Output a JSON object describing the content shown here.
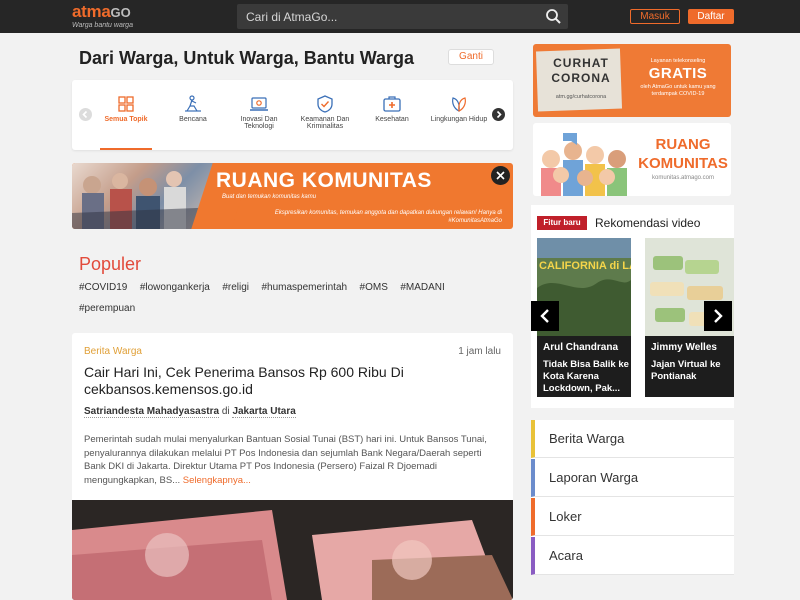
{
  "header": {
    "logo_main": "atma",
    "logo_go": "GO",
    "logo_tagline": "Warga bantu warga",
    "search_placeholder": "Cari di AtmaGo...",
    "login_label": "Masuk",
    "register_label": "Daftar"
  },
  "main": {
    "tagline": "Dari Warga, Untuk Warga, Bantu Warga",
    "change_label": "Ganti",
    "topics": [
      {
        "label": "Semua Topik",
        "icon": "grid-icon",
        "active": true
      },
      {
        "label": "Bencana",
        "icon": "disaster-icon",
        "active": false
      },
      {
        "label": "Inovasi Dan Teknologi",
        "icon": "technology-icon",
        "active": false
      },
      {
        "label": "Keamanan Dan Kriminalitas",
        "icon": "shield-icon",
        "active": false
      },
      {
        "label": "Kesehatan",
        "icon": "health-icon",
        "active": false
      },
      {
        "label": "Lingkungan Hidup",
        "icon": "leaf-icon",
        "active": false
      }
    ],
    "banner": {
      "title": "RUANG KOMUNITAS",
      "subtitle": "Buat dan temukan komunitas kamu",
      "description": "Ekspresikan komunitas, temukan anggota dan dapatkan dukungan relawan! Hanya di #KomunitasAtmaGo"
    },
    "populer": {
      "title": "Populer",
      "tags": [
        "#COVID19",
        "#lowongankerja",
        "#religi",
        "#humaspemerintah",
        "#OMS",
        "#MADANI",
        "#perempuan"
      ]
    },
    "post": {
      "category": "Berita Warga",
      "time": "1 jam lalu",
      "title": "Cair Hari Ini, Cek Penerima Bansos Rp 600 Ribu Di cekbansos.kemensos.go.id",
      "author": "Satriandesta Mahadyasastra",
      "author_prep": "di",
      "location": "Jakarta Utara",
      "excerpt": "Pemerintah sudah mulai menyalurkan Bantuan Sosial Tunai (BST) hari ini. Untuk Bansos Tunai, penyalurannya dilakukan melalui PT Pos Indonesia dan sejumlah Bank Negara/Daerah seperti Bank DKI di Jakarta. Direktur Utama PT Pos Indonesia (Persero) Faizal R Djoemadi mengungkapkan, BS...",
      "more_label": "Selengkapnya..."
    }
  },
  "sidebar": {
    "curhat": {
      "title_line1": "CURHAT",
      "title_line2": "CORONA",
      "url": "atm.gg/curhatcorona",
      "service": "Layanan telekonseling",
      "free": "GRATIS",
      "by": "oleh AtmaGo untuk kamu yang terdampak COVID-19"
    },
    "ruang_komunitas": {
      "line1": "RUANG",
      "line2": "KOMUNITAS",
      "url": "komunitas.atmago.com"
    },
    "videos": {
      "badge": "Fitur baru",
      "title": "Rekomendasi video",
      "items": [
        {
          "name": "Arul Chandrana",
          "title": "Tidak Bisa Balik ke Kota Karena Lockdown, Pak...",
          "overlay": "CALIFORNIA di LA"
        },
        {
          "name": "Jimmy Welles",
          "title": "Jajan Virtual ke Pontianak",
          "overlay": ""
        }
      ]
    },
    "categories": [
      {
        "label": "Berita Warga",
        "color": "#e9c238"
      },
      {
        "label": "Laporan Warga",
        "color": "#6b8ccc"
      },
      {
        "label": "Loker",
        "color": "#ef6b2b"
      },
      {
        "label": "Acara",
        "color": "#8a5cc2"
      }
    ]
  },
  "colors": {
    "brand_orange": "#ef6b2b",
    "topbar": "#262626",
    "populer_red": "#e24b3b"
  }
}
